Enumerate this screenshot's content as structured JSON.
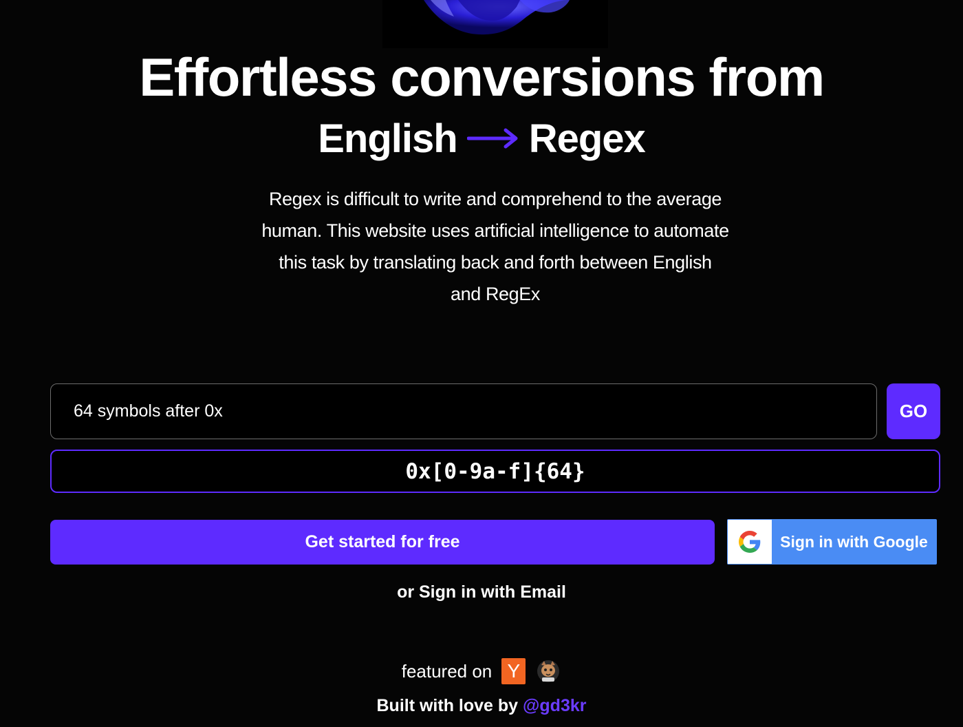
{
  "colors": {
    "background": "#050505",
    "accent": "#5e2bff",
    "google_blue": "#4a8cf4",
    "ycombinator_orange": "#f26522",
    "text": "#ffffff"
  },
  "hero": {
    "image_icon": "abstract-3d-blob-illustration",
    "headline": "Effortless conversions from",
    "from_language": "English",
    "arrow_icon": "arrow-right-icon",
    "to_language": "Regex",
    "description": "Regex is difficult to write and comprehend to the average human. This website uses artificial intelligence to automate this task by translating back and forth between English and RegEx"
  },
  "converter": {
    "input_value": "64 symbols after 0x",
    "go_label": "GO",
    "result": "0x[0-9a-f]{64}"
  },
  "auth": {
    "cta_label": "Get started for free",
    "google_icon": "google-g-icon",
    "google_label": "Sign in with Google",
    "email_label": "or Sign in with Email"
  },
  "footer": {
    "featured_label": "featured on",
    "ycombinator_letter": "Y",
    "ycombinator_icon": "ycombinator-icon",
    "producthunt_icon": "product-hunt-cat-icon",
    "built_prefix": "Built with love by",
    "author_handle": "@gd3kr"
  }
}
